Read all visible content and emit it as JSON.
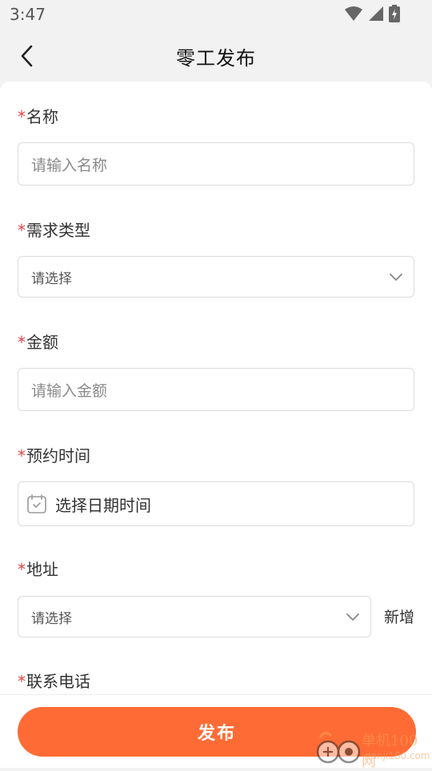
{
  "status_bar": {
    "time": "3:47"
  },
  "header": {
    "title": "零工发布"
  },
  "form": {
    "required_mark": "*",
    "name": {
      "label": "名称",
      "placeholder": "请输入名称"
    },
    "demand_type": {
      "label": "需求类型",
      "placeholder": "请选择"
    },
    "amount": {
      "label": "金额",
      "placeholder": "请输入金额"
    },
    "appointment_time": {
      "label": "预约时间",
      "placeholder": "选择日期时间"
    },
    "address": {
      "label": "地址",
      "placeholder": "请选择",
      "add_label": "新增"
    },
    "phone": {
      "label": "联系电话"
    }
  },
  "footer": {
    "publish_label": "发布"
  },
  "watermark": {
    "line1": "单机100网",
    "line2": "danji100.com"
  },
  "colors": {
    "accent": "#ff6b35",
    "required": "#e04545",
    "background": "#f2f2f2"
  },
  "icons": [
    "back-arrow-icon",
    "chevron-down-icon",
    "calendar-icon",
    "wifi-icon",
    "signal-icon",
    "battery-icon"
  ]
}
